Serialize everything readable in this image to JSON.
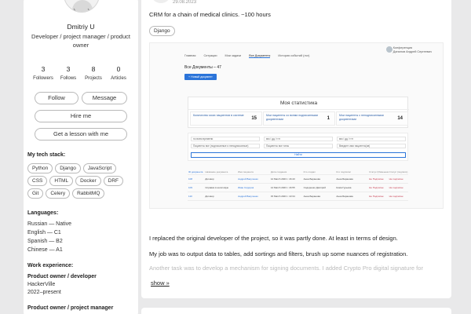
{
  "profile": {
    "name": "Dmitriy U",
    "role": "Developer / project manager / product owner",
    "stats": [
      {
        "num": "3",
        "label": "Followers"
      },
      {
        "num": "3",
        "label": "Follows"
      },
      {
        "num": "8",
        "label": "Projects"
      },
      {
        "num": "0",
        "label": "Articles"
      }
    ],
    "buttons": {
      "follow": "Follow",
      "message": "Message",
      "hire": "Hire me",
      "lesson": "Get a lesson with me"
    },
    "tech_title": "My tech stack:",
    "tech": [
      "Python",
      "Django",
      "JavaScript",
      "CSS",
      "HTML",
      "Docker",
      "DRF",
      "Git",
      "Celery",
      "RabbitMQ"
    ],
    "languages_title": "Languages:",
    "languages": [
      "Russian — Native",
      "English — C1",
      "Spanish — B2",
      "Chinese — A1"
    ],
    "work_title": "Work experience:",
    "jobs": [
      {
        "title": "Product owner / developer",
        "company": "HackerVille",
        "period": "2022–present"
      },
      {
        "title": "Product owner / project manager",
        "company": "",
        "period": ""
      }
    ]
  },
  "project": {
    "date": "29.08.2023",
    "description": "CRM for a chain of medical clinics. ~100 hours",
    "tag": "Django",
    "screenshot": {
      "user_line1": "Конференция",
      "user_line2": "Данилов Андрей Сергеевич",
      "tabs": [
        "Главная",
        "Ситуации",
        "Мои задачи",
        "Все Документы",
        "История событий (лог)"
      ],
      "heading": "Все Документы – 47",
      "new_button": "+ Новый документ",
      "stats_title": "Моя статистика",
      "stat_cells": [
        {
          "label": "Количество моих пациентов в системе",
          "value": "15"
        },
        {
          "label": "Мои пациенты со всеми подписанными документами",
          "value": "1"
        },
        {
          "label": "Мои пациенты с неподписанными документами",
          "value": "14"
        }
      ],
      "filters": [
        "по всем времени",
        "мм / дд / гггг",
        "мм / дд / гггг",
        "Пациенты все (подписанные и неподписанные)",
        "Пациенты все типы",
        "Введите имя пациента(ов)"
      ],
      "filter_button": "Найти",
      "table_headers": [
        "ID документа",
        "Название документа",
        "Имя пациента",
        "Дата создания",
        "Кто создал",
        "Кто подписал",
        "Статус (Изменения)",
        "Статус (подписи)"
      ],
      "rows": [
        [
          "108",
          "Договор",
          "Андрей Вакуленко",
          "14 March 2023 г. 16:43",
          "Анна Баранова",
          "Анна Баранова",
          "Не Подписан",
          "Не подписан"
        ],
        [
          "109",
          "Справка в налоговую",
          "Иван Сидоров",
          "14 March 2023 г. 16:55",
          "Сидоренко Дмитрий",
          "Кима Гурьева",
          "Не Подписан",
          "Не подписан"
        ],
        [
          "110",
          "Договор",
          "Андрей Вакуленко",
          "15 March 2023 г. 13:34",
          "Анна Баранова",
          "Анна Баранова",
          "Не Подписан",
          "Не подписан"
        ]
      ]
    },
    "paragraphs": [
      "I replaced the original developer of the project, so it was partly done. At least in terms of design.",
      "My job was to output data to tables, add sortings and filters, brush up some nuances of registration.",
      "Another task was to develop a mechanism for signing documents. I added Crypto Pro digital signature for"
    ],
    "show_more": "show »"
  },
  "colors": {
    "accent": "#2b74d9",
    "background": "#e9e9ea",
    "card": "#ffffff"
  }
}
